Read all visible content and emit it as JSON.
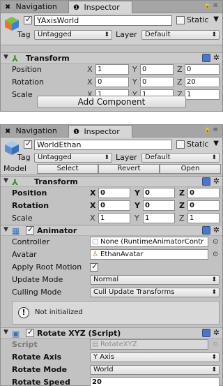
{
  "panel1": {
    "tabs": [
      {
        "label": "Navigation",
        "icon": "navigation-icon"
      },
      {
        "label": "Inspector",
        "icon": "info-icon"
      }
    ],
    "object": {
      "name": "YAxisWorld",
      "active": true,
      "static_label": "Static",
      "static_checked": false,
      "tag_label": "Tag",
      "tag_value": "Untagged",
      "layer_label": "Layer",
      "layer_value": "Default"
    },
    "transform": {
      "title": "Transform",
      "rows": [
        {
          "label": "Position",
          "x": "1",
          "y": "0",
          "z": "0"
        },
        {
          "label": "Rotation",
          "x": "0",
          "y": "0",
          "z": "20"
        },
        {
          "label": "Scale",
          "x": "1",
          "y": "1",
          "z": "1"
        }
      ],
      "axis_labels": [
        "X",
        "Y",
        "Z"
      ]
    },
    "add_component_label": "Add Component"
  },
  "panel2": {
    "tabs": [
      {
        "label": "Navigation",
        "icon": "navigation-icon"
      },
      {
        "label": "Inspector",
        "icon": "info-icon"
      }
    ],
    "object": {
      "name": "WorldEthan",
      "active": true,
      "static_label": "Static",
      "static_checked": false,
      "tag_label": "Tag",
      "tag_value": "Untagged",
      "layer_label": "Layer",
      "layer_value": "Default"
    },
    "model": {
      "label": "Model",
      "buttons": [
        "Select",
        "Revert",
        "Open"
      ]
    },
    "transform": {
      "title": "Transform",
      "rows": [
        {
          "label": "Position",
          "x": "0",
          "y": "0",
          "z": "0",
          "bold": true
        },
        {
          "label": "Rotation",
          "x": "0",
          "y": "0",
          "z": "0",
          "bold": true
        },
        {
          "label": "Scale",
          "x": "1",
          "y": "1",
          "z": "1",
          "bold": false
        }
      ],
      "axis_labels": [
        "X",
        "Y",
        "Z"
      ]
    },
    "animator": {
      "title": "Animator",
      "enabled": true,
      "controller_label": "Controller",
      "controller_value": "None (RuntimeAnimatorContr",
      "avatar_label": "Avatar",
      "avatar_value": "EthanAvatar",
      "apply_root_motion_label": "Apply Root Motion",
      "apply_root_motion": true,
      "update_mode_label": "Update Mode",
      "update_mode_value": "Normal",
      "culling_mode_label": "Culling Mode",
      "culling_mode_value": "Cull Update Transforms",
      "help_message": "Not initialized"
    },
    "rotate_script": {
      "title": "Rotate XYZ (Script)",
      "enabled": true,
      "script_label": "Script",
      "script_value": "RotateXYZ",
      "axis_label": "Rotate Axis",
      "axis_value": "Y Axis",
      "mode_label": "Rotate Mode",
      "mode_value": "World",
      "speed_label": "Rotate Speed",
      "speed_value": "20"
    }
  }
}
